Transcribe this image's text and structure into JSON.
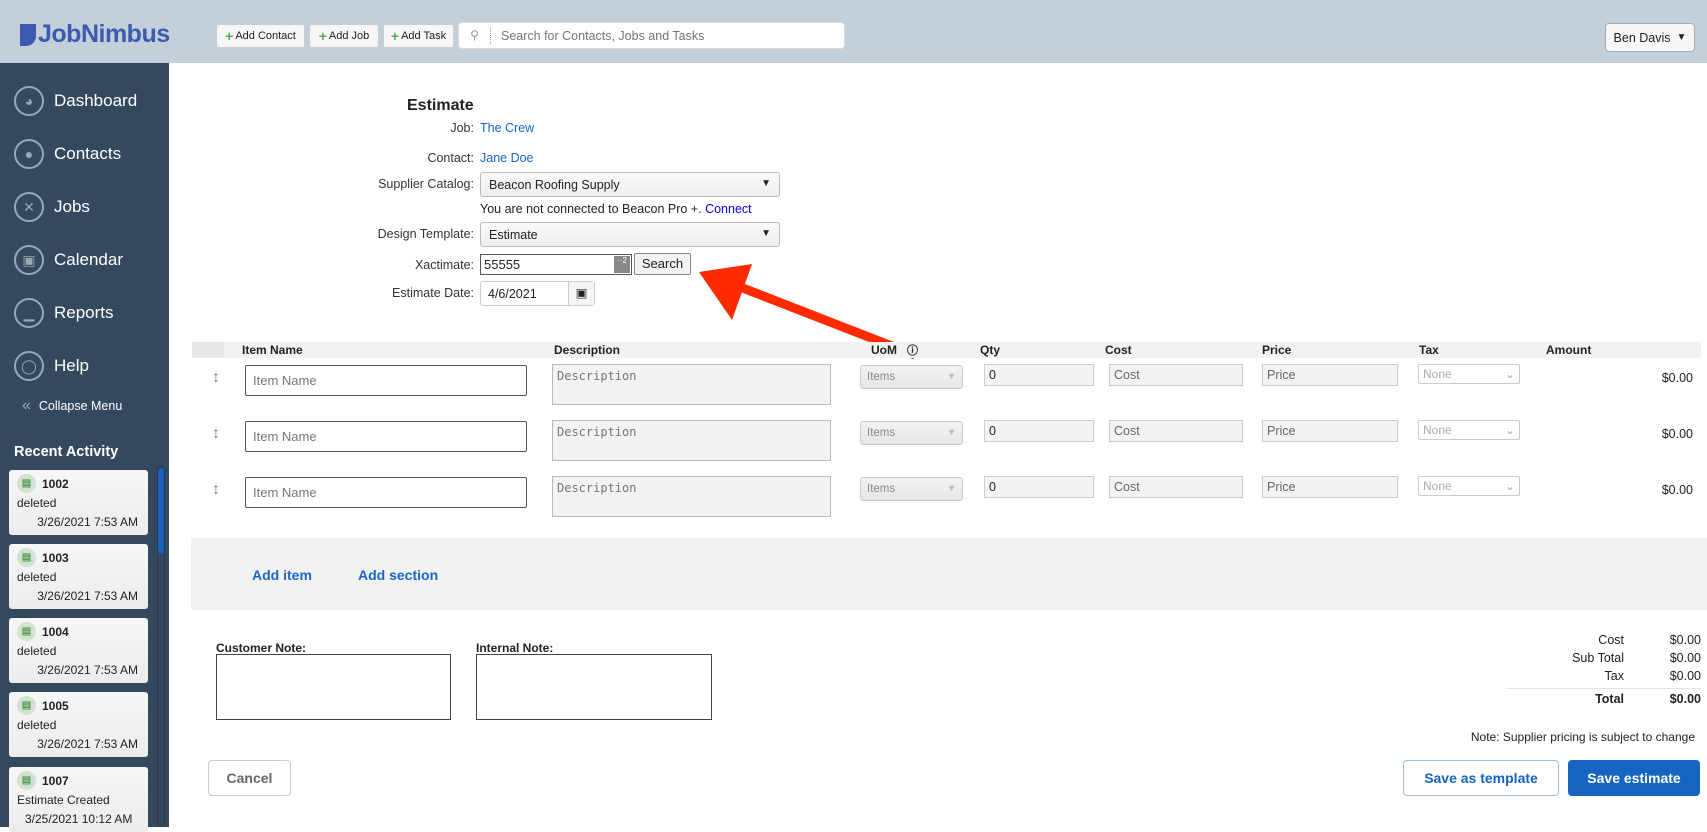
{
  "header": {
    "logo": "JobNimbus",
    "add_contact": "Add Contact",
    "add_job": "Add Job",
    "add_task": "Add Task",
    "search_placeholder": "Search for Contacts, Jobs and Tasks",
    "user": "Ben Davis"
  },
  "sidebar": {
    "items": [
      {
        "label": "Dashboard",
        "icon": "dashboard-icon"
      },
      {
        "label": "Contacts",
        "icon": "contact-icon"
      },
      {
        "label": "Jobs",
        "icon": "tools-icon"
      },
      {
        "label": "Calendar",
        "icon": "calendar-icon"
      },
      {
        "label": "Reports",
        "icon": "chart-icon"
      },
      {
        "label": "Help",
        "icon": "lifebuoy-icon"
      }
    ],
    "collapse": "Collapse Menu",
    "recent_title": "Recent Activity",
    "activity": [
      {
        "id": "1002",
        "action": "deleted",
        "time": "3/26/2021 7:53 AM"
      },
      {
        "id": "1003",
        "action": "deleted",
        "time": "3/26/2021 7:53 AM"
      },
      {
        "id": "1004",
        "action": "deleted",
        "time": "3/26/2021 7:53 AM"
      },
      {
        "id": "1005",
        "action": "deleted",
        "time": "3/26/2021 7:53 AM"
      },
      {
        "id": "1007",
        "action": "Estimate Created",
        "time": "3/25/2021 10:12 AM"
      }
    ]
  },
  "form": {
    "title": "Estimate",
    "job_label": "Job:",
    "job": "The Crew",
    "contact_label": "Contact:",
    "contact": "Jane Doe",
    "supplier_label": "Supplier Catalog:",
    "supplier": "Beacon Roofing Supply",
    "connect_text": "You are not connected to Beacon Pro +.",
    "connect_link": "Connect",
    "template_label": "Design Template:",
    "template": "Estimate",
    "xactimate_label": "Xactimate:",
    "xactimate": "55555",
    "search_btn": "Search",
    "date_label": "Estimate Date:",
    "date": "4/6/2021"
  },
  "table": {
    "columns": [
      "Item Name",
      "Description",
      "UoM",
      "Qty",
      "Cost",
      "Price",
      "Tax",
      "Amount"
    ],
    "rows": [
      {
        "item_ph": "Item Name",
        "desc_ph": "Description",
        "uom": "Items",
        "qty": "0",
        "cost_ph": "Cost",
        "price_ph": "Price",
        "tax": "None",
        "amount": "$0.00"
      },
      {
        "item_ph": "Item Name",
        "desc_ph": "Description",
        "uom": "Items",
        "qty": "0",
        "cost_ph": "Cost",
        "price_ph": "Price",
        "tax": "None",
        "amount": "$0.00"
      },
      {
        "item_ph": "Item Name",
        "desc_ph": "Description",
        "uom": "Items",
        "qty": "0",
        "cost_ph": "Cost",
        "price_ph": "Price",
        "tax": "None",
        "amount": "$0.00"
      }
    ]
  },
  "actions": {
    "add_item": "Add item",
    "add_section": "Add section"
  },
  "notes": {
    "customer": "Customer Note:",
    "internal": "Internal Note:"
  },
  "totals": {
    "cost_label": "Cost",
    "cost": "$0.00",
    "subtotal_label": "Sub Total",
    "subtotal": "$0.00",
    "tax_label": "Tax",
    "tax": "$0.00",
    "total_label": "Total",
    "total": "$0.00",
    "note": "Note: Supplier pricing is subject to change"
  },
  "buttons": {
    "cancel": "Cancel",
    "save_template": "Save as template",
    "save_estimate": "Save estimate"
  },
  "colors": {
    "brand": "#3d5ab2",
    "sidebar": "#34495e",
    "primary": "#1565c0",
    "annotation_arrow": "#ff2a00"
  }
}
